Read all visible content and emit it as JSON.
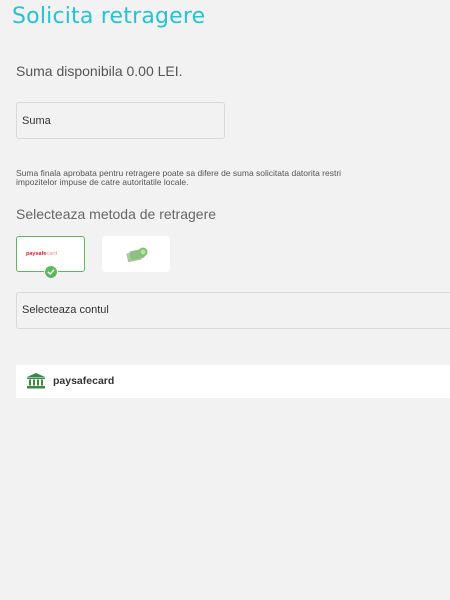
{
  "page": {
    "title": "Solicita retragere",
    "balance_text": "Suma disponibila 0.00 LEI.",
    "amount_placeholder": "Suma",
    "disclaimer_line1": "Suma finala aprobata pentru retragere poate sa difere de suma solicitata datorita restri",
    "disclaimer_line2": "impozitelor impuse de catre autoritatile locale.",
    "method_heading": "Selecteaza metoda de retragere"
  },
  "methods": [
    {
      "name": "paysafecard",
      "logo_bold": "paysafe",
      "logo_light": "card",
      "selected": true,
      "icon": "paysafecard-logo"
    },
    {
      "name": "cash",
      "selected": false,
      "icon": "cash-icon"
    }
  ],
  "account": {
    "select_label": "Selecteaza contul",
    "item_label": "paysafecard",
    "item_icon": "bank-icon"
  },
  "colors": {
    "accent": "#24c3d6",
    "success": "#5cb85c",
    "bank_icon": "#3a8a45",
    "paysafe_red": "#d8242f",
    "background": "#f2f2f2"
  }
}
